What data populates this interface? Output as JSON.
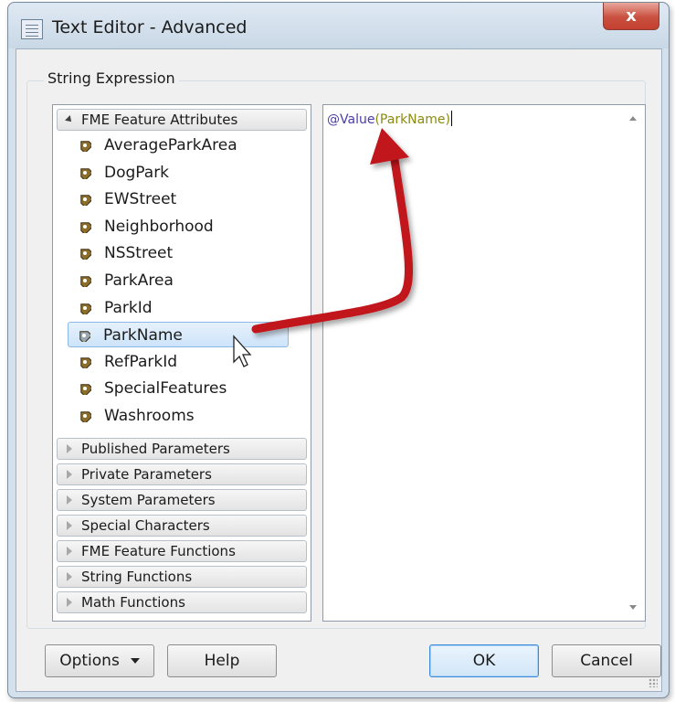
{
  "window": {
    "title": "Text Editor - Advanced",
    "close_label": "x"
  },
  "group": {
    "label": "String Expression"
  },
  "attributes_section": {
    "label": "FME Feature Attributes",
    "expanded": true,
    "items": [
      {
        "label": "AverageParkArea"
      },
      {
        "label": "DogPark"
      },
      {
        "label": "EWStreet"
      },
      {
        "label": "Neighborhood"
      },
      {
        "label": "NSStreet"
      },
      {
        "label": "ParkArea"
      },
      {
        "label": "ParkId"
      },
      {
        "label": "ParkName",
        "selected": true
      },
      {
        "label": "RefParkId"
      },
      {
        "label": "SpecialFeatures"
      },
      {
        "label": "Washrooms"
      }
    ]
  },
  "collapsed_sections": [
    {
      "label": "Published Parameters"
    },
    {
      "label": "Private Parameters"
    },
    {
      "label": "System Parameters"
    },
    {
      "label": "Special Characters"
    },
    {
      "label": "FME Feature Functions"
    },
    {
      "label": "String Functions"
    },
    {
      "label": "Math Functions"
    }
  ],
  "editor": {
    "function": "@Value",
    "open_paren": "(",
    "argument": "ParkName",
    "close_paren": ")"
  },
  "buttons": {
    "options": "Options",
    "help": "Help",
    "ok": "OK",
    "cancel": "Cancel"
  },
  "colors": {
    "function_color": "#4b3ca8",
    "argument_color": "#8a8a12",
    "arrow_color": "#c0121a",
    "selection": "#cde4fa"
  }
}
